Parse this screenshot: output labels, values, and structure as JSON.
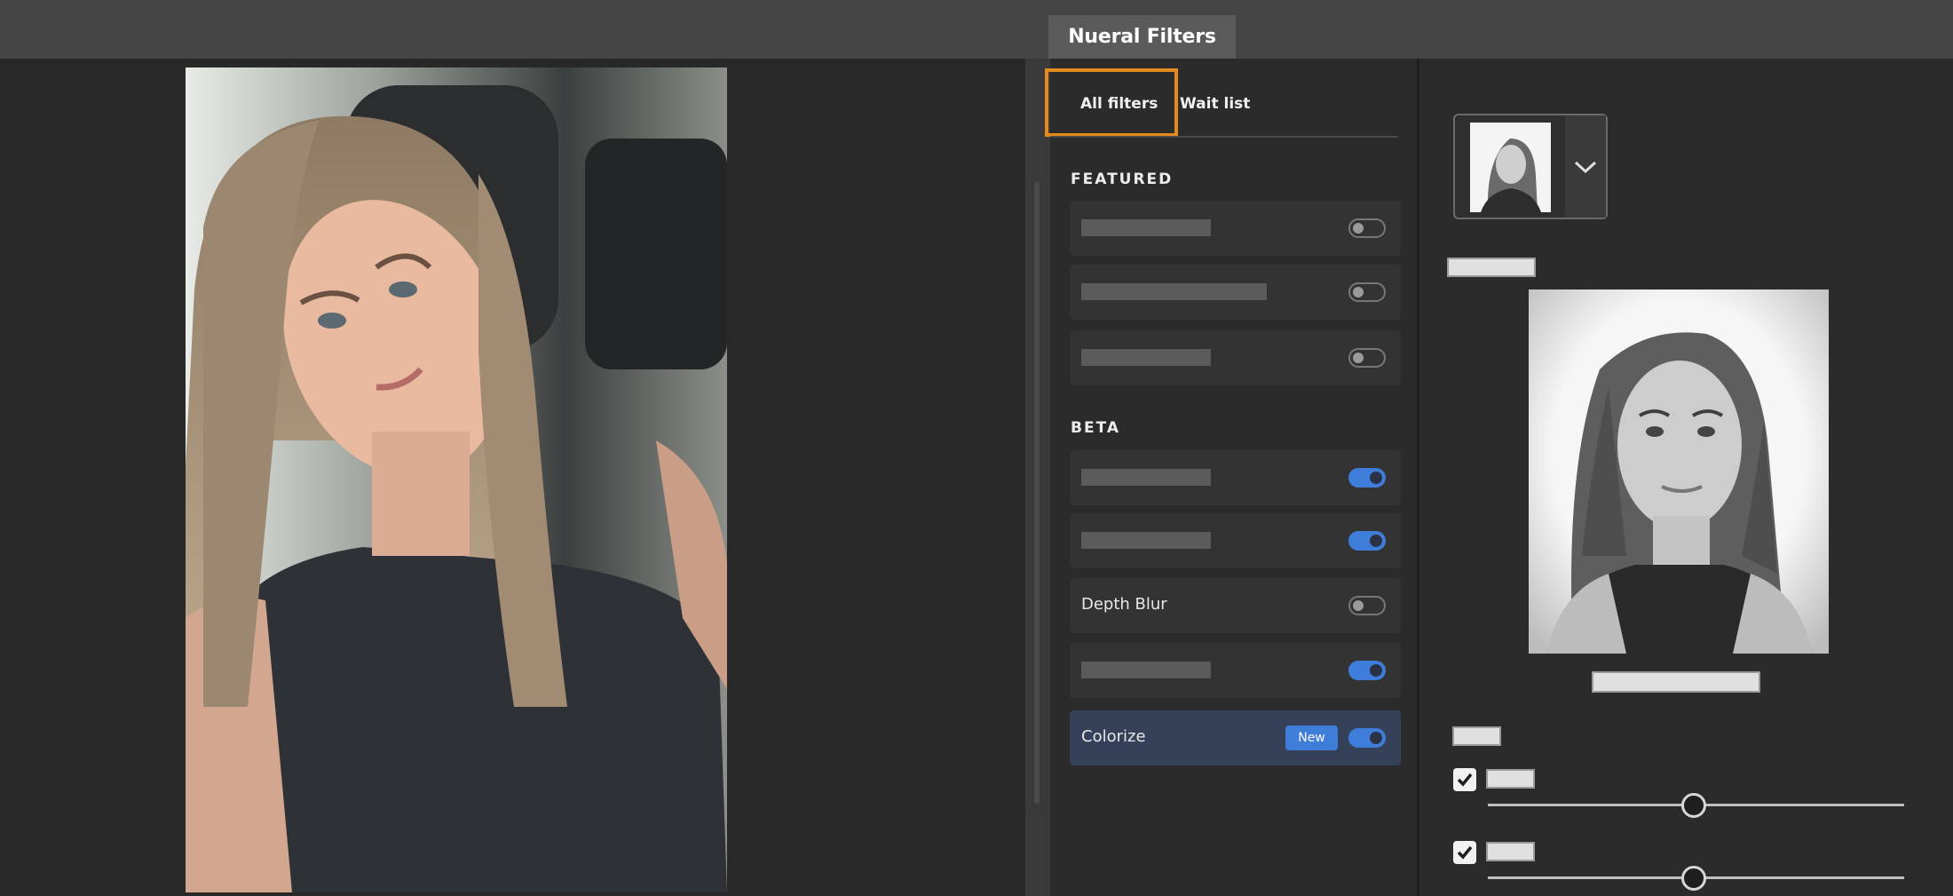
{
  "window": {
    "active_tab": "Nueral Filters"
  },
  "filter_tabs": {
    "all": "All filters",
    "wait": "Wait list"
  },
  "sections": {
    "featured": "FEATURED",
    "beta": "BETA"
  },
  "filters": {
    "featured": [
      {
        "label": "",
        "enabled": false
      },
      {
        "label": "",
        "enabled": false
      },
      {
        "label": "",
        "enabled": false
      }
    ],
    "beta": [
      {
        "label": "",
        "enabled": true
      },
      {
        "label": "",
        "enabled": true
      },
      {
        "label": "Depth Blur",
        "enabled": false
      },
      {
        "label": "",
        "enabled": true
      },
      {
        "label": "Colorize",
        "enabled": true,
        "badge": "New",
        "selected": true
      }
    ]
  },
  "right_panel": {
    "checkbox_1": true,
    "checkbox_2": true,
    "slider_1": 0.5,
    "slider_2": 0.5
  },
  "colors": {
    "accent": "#3f7ddb",
    "highlight": "#e48a1c",
    "selected_row": "#354059"
  },
  "icons": {
    "dropdown": "chevron-down-icon",
    "check": "checkmark-icon"
  }
}
